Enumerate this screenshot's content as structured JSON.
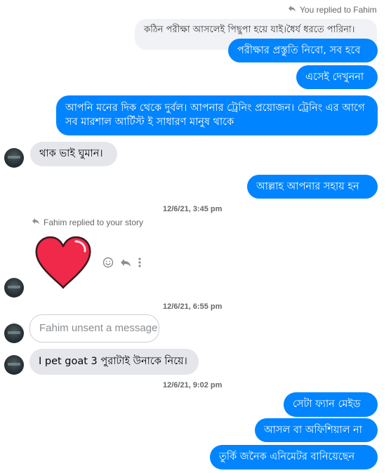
{
  "messages": {
    "reply_to_fahim": "You replied to Fahim",
    "quoted_message": "কঠিন পরীক্ষা আসলেই পিছুপা হয়ে যাই।ধৈর্য ধরতে পারিনা।",
    "out_1": "পরীক্ষার প্রস্তুতি নিবো, সব হবে",
    "out_2": "এসেই দেখুননা",
    "out_3": "আপনি মনের দিক থেকে দুর্বল। আপনার ট্রেনিং প্রয়োজন। ট্রেনিং এর আগে সব মারশাল আর্টিস্ট ই সাধারণ মানুষ থাকে",
    "in_1": "থাক ভাই ঘুমান।",
    "out_4": "আল্লাহ আপনার সহায় হন",
    "timestamp_1": "12/6/21, 3:45 pm",
    "fahim_replied_story": "Fahim replied to your story",
    "timestamp_2": "12/6/21, 6:55 pm",
    "unsent_notice": "Fahim unsent a message",
    "in_2": "I pet goat 3 পুরাটাই উনাকে নিয়ে।",
    "timestamp_3": "12/6/21, 9:02 pm",
    "out_5": "সেটা ফ্যান মেইড",
    "out_6": "আসল বা অফিশিয়াল না",
    "out_7": "তুর্কি জনৈক এনিমেটর বানিয়েছেন"
  },
  "icons": {
    "reply_arrow": "reply-arrow-icon",
    "heart_sticker": "heart-icon",
    "react": "smiley-icon",
    "reply": "reply-icon",
    "more": "more-options-icon"
  },
  "colors": {
    "outgoing_bubble": "#0084ff",
    "incoming_bubble": "#e4e6eb",
    "heart": "#f02849"
  }
}
